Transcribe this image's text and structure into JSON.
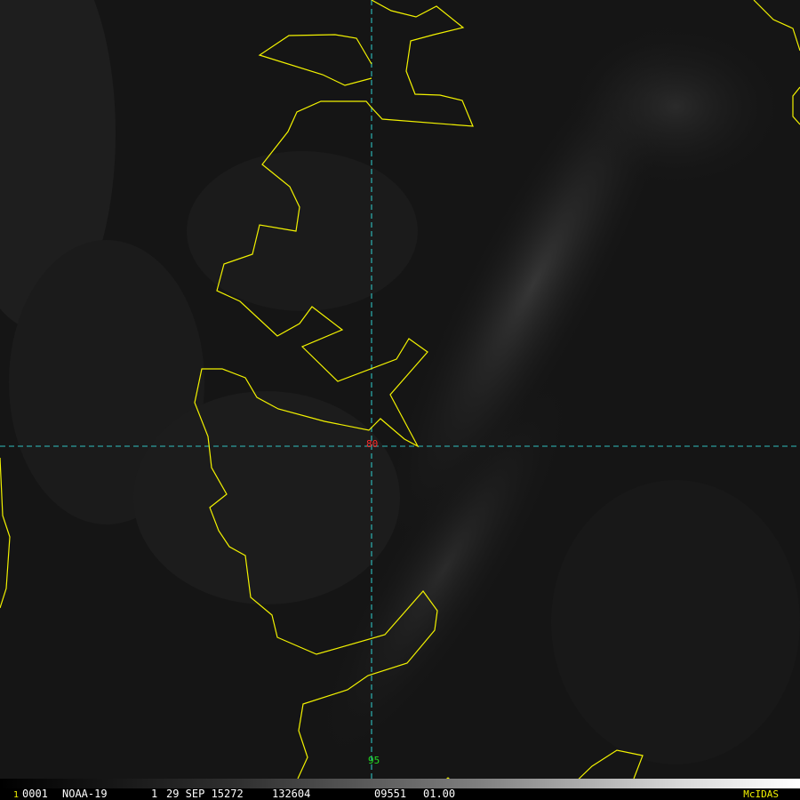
{
  "map": {
    "grid_labels": {
      "latitude": "80",
      "longitude": "95"
    },
    "colors": {
      "coastline": "#f2f200",
      "grid": "#2fc0c0",
      "lat_label": "#ff2a2a",
      "lon_label": "#22dd22",
      "background": "#141414"
    }
  },
  "status": {
    "frame_marker": "1",
    "frame": "0001",
    "satellite": "NOAA-19",
    "day": "1",
    "date": "29 SEP 15272",
    "time": "132604",
    "band": "09551",
    "resolution": "01.00",
    "brand": "McIDAS"
  }
}
